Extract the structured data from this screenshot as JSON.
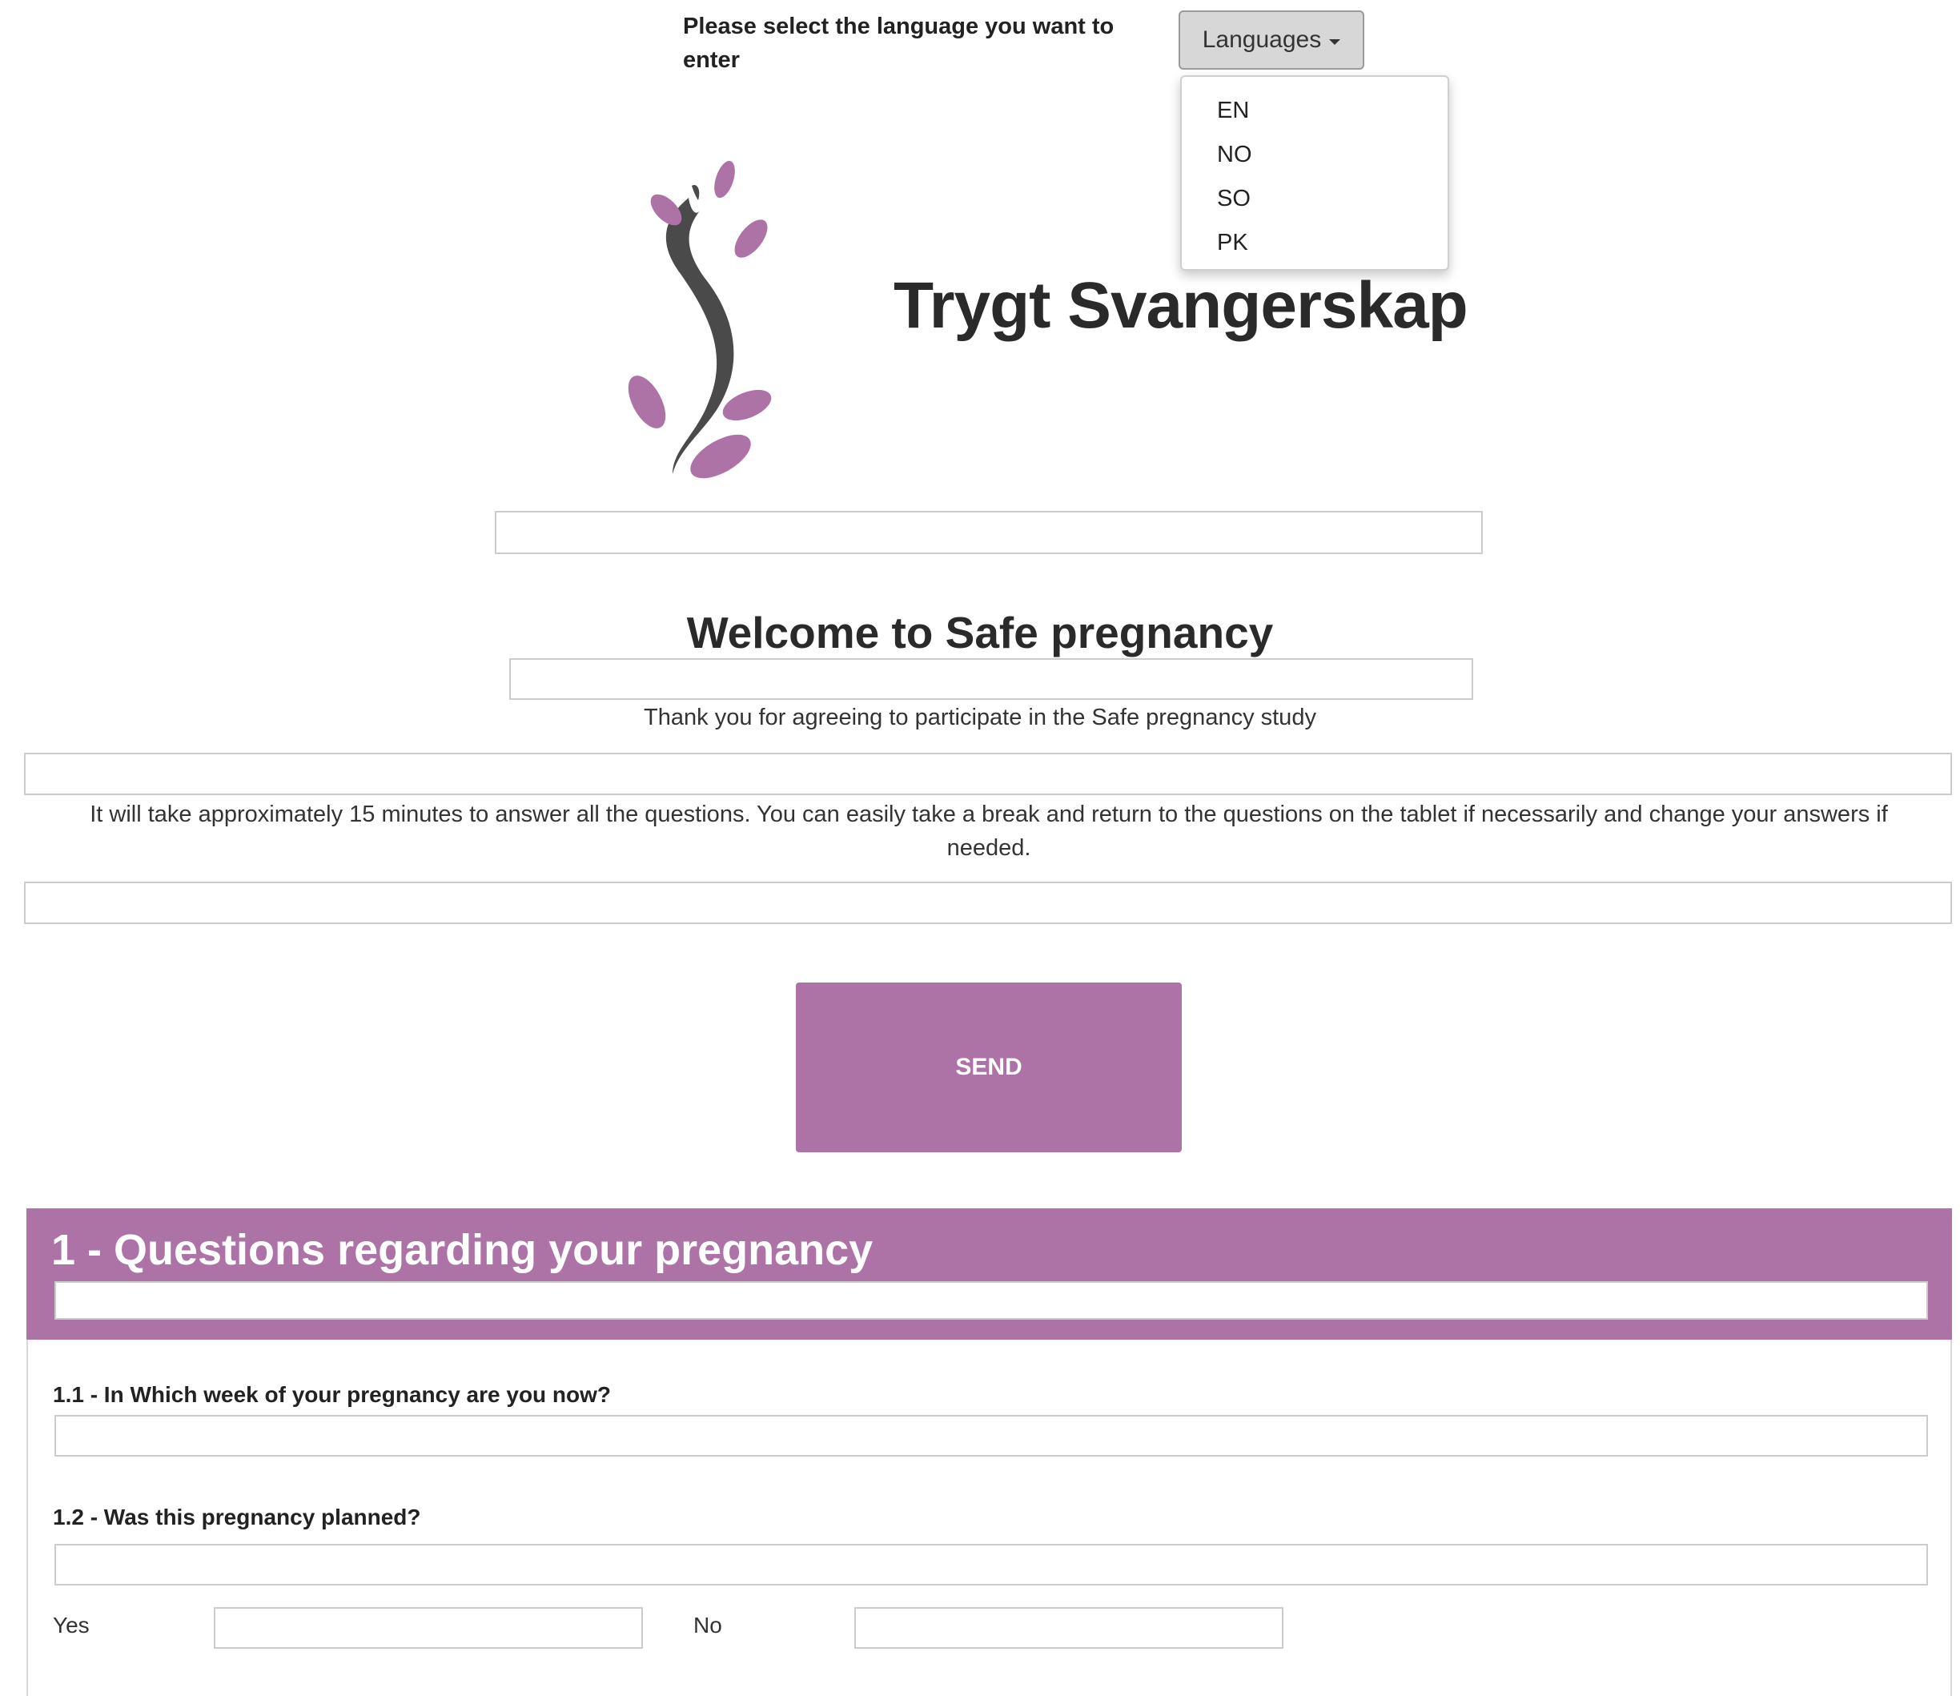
{
  "language": {
    "prompt": "Please select the language you want to enter",
    "button_label": "Languages",
    "options": [
      "EN",
      "NO",
      "SO",
      "PK"
    ]
  },
  "header": {
    "title": "Trygt Svangerskap"
  },
  "intro": {
    "welcome": "Welcome to Safe pregnancy",
    "thanks": "Thank you for agreeing to participate in the Safe pregnancy study",
    "info": "It will take approximately 15 minutes to answer all the questions. You can easily take a break and return to the questions on the tablet if necessarily and change your answers if needed."
  },
  "send": {
    "label": "SEND"
  },
  "section1": {
    "title": "1 - Questions regarding your pregnancy",
    "q1": "1.1 - In Which week of your pregnancy are you now?",
    "q2": "1.2 - Was this pregnancy planned?",
    "yes_label": "Yes",
    "no_label": "No"
  },
  "colors": {
    "accent": "#ad72a6",
    "logo_stem": "#4a4a4a",
    "border": "#cccccc"
  },
  "icons": {
    "logo": "pregnancy-vine-logo-icon",
    "caret": "caret-down-icon"
  }
}
